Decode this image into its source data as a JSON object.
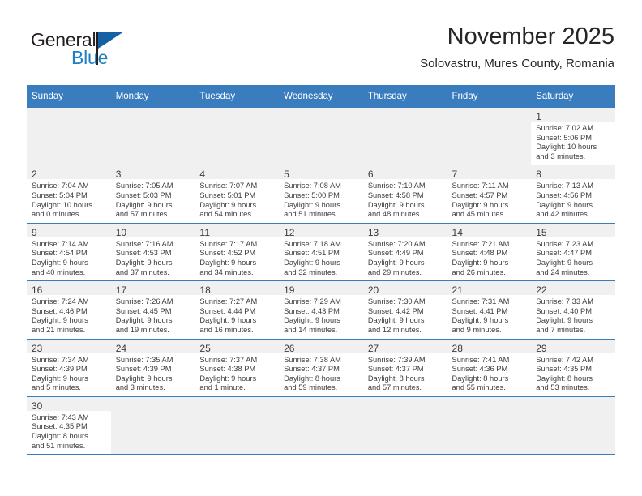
{
  "brand": {
    "name_part1": "General",
    "name_part2": "Blue",
    "triangle_color": "#1461a5",
    "blue_color": "#1f7fc4"
  },
  "header": {
    "title": "November 2025",
    "subtitle": "Solovastru, Mures County, Romania"
  },
  "theme": {
    "header_bg": "#3a7dbf",
    "header_text": "#ffffff",
    "cell_shade": "#f0f0f0",
    "text": "#3c3c3c"
  },
  "weekdays": [
    "Sunday",
    "Monday",
    "Tuesday",
    "Wednesday",
    "Thursday",
    "Friday",
    "Saturday"
  ],
  "weeks": [
    [
      {
        "empty": true
      },
      {
        "empty": true
      },
      {
        "empty": true
      },
      {
        "empty": true
      },
      {
        "empty": true
      },
      {
        "empty": true
      },
      {
        "day": "1",
        "sunrise": "Sunrise: 7:02 AM",
        "sunset": "Sunset: 5:06 PM",
        "daylight1": "Daylight: 10 hours",
        "daylight2": "and 3 minutes."
      }
    ],
    [
      {
        "day": "2",
        "sunrise": "Sunrise: 7:04 AM",
        "sunset": "Sunset: 5:04 PM",
        "daylight1": "Daylight: 10 hours",
        "daylight2": "and 0 minutes."
      },
      {
        "day": "3",
        "sunrise": "Sunrise: 7:05 AM",
        "sunset": "Sunset: 5:03 PM",
        "daylight1": "Daylight: 9 hours",
        "daylight2": "and 57 minutes."
      },
      {
        "day": "4",
        "sunrise": "Sunrise: 7:07 AM",
        "sunset": "Sunset: 5:01 PM",
        "daylight1": "Daylight: 9 hours",
        "daylight2": "and 54 minutes."
      },
      {
        "day": "5",
        "sunrise": "Sunrise: 7:08 AM",
        "sunset": "Sunset: 5:00 PM",
        "daylight1": "Daylight: 9 hours",
        "daylight2": "and 51 minutes."
      },
      {
        "day": "6",
        "sunrise": "Sunrise: 7:10 AM",
        "sunset": "Sunset: 4:58 PM",
        "daylight1": "Daylight: 9 hours",
        "daylight2": "and 48 minutes."
      },
      {
        "day": "7",
        "sunrise": "Sunrise: 7:11 AM",
        "sunset": "Sunset: 4:57 PM",
        "daylight1": "Daylight: 9 hours",
        "daylight2": "and 45 minutes."
      },
      {
        "day": "8",
        "sunrise": "Sunrise: 7:13 AM",
        "sunset": "Sunset: 4:56 PM",
        "daylight1": "Daylight: 9 hours",
        "daylight2": "and 42 minutes."
      }
    ],
    [
      {
        "day": "9",
        "sunrise": "Sunrise: 7:14 AM",
        "sunset": "Sunset: 4:54 PM",
        "daylight1": "Daylight: 9 hours",
        "daylight2": "and 40 minutes."
      },
      {
        "day": "10",
        "sunrise": "Sunrise: 7:16 AM",
        "sunset": "Sunset: 4:53 PM",
        "daylight1": "Daylight: 9 hours",
        "daylight2": "and 37 minutes."
      },
      {
        "day": "11",
        "sunrise": "Sunrise: 7:17 AM",
        "sunset": "Sunset: 4:52 PM",
        "daylight1": "Daylight: 9 hours",
        "daylight2": "and 34 minutes."
      },
      {
        "day": "12",
        "sunrise": "Sunrise: 7:18 AM",
        "sunset": "Sunset: 4:51 PM",
        "daylight1": "Daylight: 9 hours",
        "daylight2": "and 32 minutes."
      },
      {
        "day": "13",
        "sunrise": "Sunrise: 7:20 AM",
        "sunset": "Sunset: 4:49 PM",
        "daylight1": "Daylight: 9 hours",
        "daylight2": "and 29 minutes."
      },
      {
        "day": "14",
        "sunrise": "Sunrise: 7:21 AM",
        "sunset": "Sunset: 4:48 PM",
        "daylight1": "Daylight: 9 hours",
        "daylight2": "and 26 minutes."
      },
      {
        "day": "15",
        "sunrise": "Sunrise: 7:23 AM",
        "sunset": "Sunset: 4:47 PM",
        "daylight1": "Daylight: 9 hours",
        "daylight2": "and 24 minutes."
      }
    ],
    [
      {
        "day": "16",
        "sunrise": "Sunrise: 7:24 AM",
        "sunset": "Sunset: 4:46 PM",
        "daylight1": "Daylight: 9 hours",
        "daylight2": "and 21 minutes."
      },
      {
        "day": "17",
        "sunrise": "Sunrise: 7:26 AM",
        "sunset": "Sunset: 4:45 PM",
        "daylight1": "Daylight: 9 hours",
        "daylight2": "and 19 minutes."
      },
      {
        "day": "18",
        "sunrise": "Sunrise: 7:27 AM",
        "sunset": "Sunset: 4:44 PM",
        "daylight1": "Daylight: 9 hours",
        "daylight2": "and 16 minutes."
      },
      {
        "day": "19",
        "sunrise": "Sunrise: 7:29 AM",
        "sunset": "Sunset: 4:43 PM",
        "daylight1": "Daylight: 9 hours",
        "daylight2": "and 14 minutes."
      },
      {
        "day": "20",
        "sunrise": "Sunrise: 7:30 AM",
        "sunset": "Sunset: 4:42 PM",
        "daylight1": "Daylight: 9 hours",
        "daylight2": "and 12 minutes."
      },
      {
        "day": "21",
        "sunrise": "Sunrise: 7:31 AM",
        "sunset": "Sunset: 4:41 PM",
        "daylight1": "Daylight: 9 hours",
        "daylight2": "and 9 minutes."
      },
      {
        "day": "22",
        "sunrise": "Sunrise: 7:33 AM",
        "sunset": "Sunset: 4:40 PM",
        "daylight1": "Daylight: 9 hours",
        "daylight2": "and 7 minutes."
      }
    ],
    [
      {
        "day": "23",
        "sunrise": "Sunrise: 7:34 AM",
        "sunset": "Sunset: 4:39 PM",
        "daylight1": "Daylight: 9 hours",
        "daylight2": "and 5 minutes."
      },
      {
        "day": "24",
        "sunrise": "Sunrise: 7:35 AM",
        "sunset": "Sunset: 4:39 PM",
        "daylight1": "Daylight: 9 hours",
        "daylight2": "and 3 minutes."
      },
      {
        "day": "25",
        "sunrise": "Sunrise: 7:37 AM",
        "sunset": "Sunset: 4:38 PM",
        "daylight1": "Daylight: 9 hours",
        "daylight2": "and 1 minute."
      },
      {
        "day": "26",
        "sunrise": "Sunrise: 7:38 AM",
        "sunset": "Sunset: 4:37 PM",
        "daylight1": "Daylight: 8 hours",
        "daylight2": "and 59 minutes."
      },
      {
        "day": "27",
        "sunrise": "Sunrise: 7:39 AM",
        "sunset": "Sunset: 4:37 PM",
        "daylight1": "Daylight: 8 hours",
        "daylight2": "and 57 minutes."
      },
      {
        "day": "28",
        "sunrise": "Sunrise: 7:41 AM",
        "sunset": "Sunset: 4:36 PM",
        "daylight1": "Daylight: 8 hours",
        "daylight2": "and 55 minutes."
      },
      {
        "day": "29",
        "sunrise": "Sunrise: 7:42 AM",
        "sunset": "Sunset: 4:35 PM",
        "daylight1": "Daylight: 8 hours",
        "daylight2": "and 53 minutes."
      }
    ],
    [
      {
        "day": "30",
        "sunrise": "Sunrise: 7:43 AM",
        "sunset": "Sunset: 4:35 PM",
        "daylight1": "Daylight: 8 hours",
        "daylight2": "and 51 minutes."
      },
      {
        "empty": true
      },
      {
        "empty": true
      },
      {
        "empty": true
      },
      {
        "empty": true
      },
      {
        "empty": true
      },
      {
        "empty": true
      }
    ]
  ]
}
